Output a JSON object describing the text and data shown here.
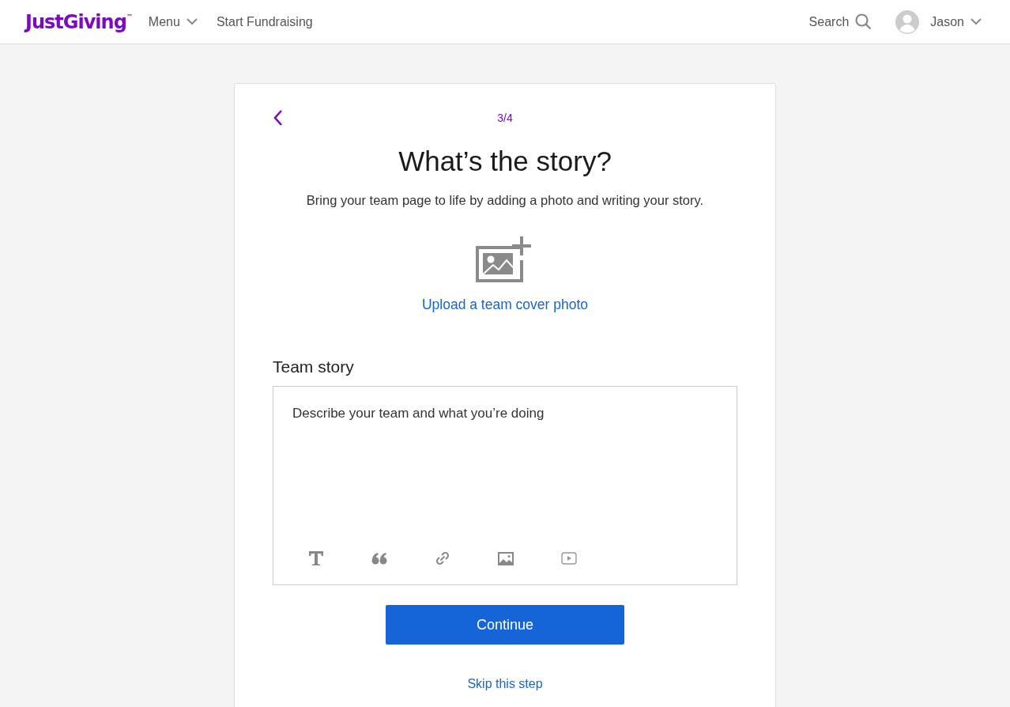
{
  "header": {
    "logo": "JustGiving",
    "logo_mark": "™",
    "menu": "Menu",
    "start": "Start Fundraising",
    "search": "Search",
    "user": "Jason"
  },
  "card": {
    "step": "3/4",
    "title": "What’s the story?",
    "subtitle": "Bring your team page to life by adding a photo and writing your story.",
    "upload": "Upload a team cover photo",
    "story_label": "Team story",
    "story": {
      "placeholder": "Describe your team and what you’re doing"
    },
    "continue": "Continue",
    "skip": "Skip this step"
  }
}
